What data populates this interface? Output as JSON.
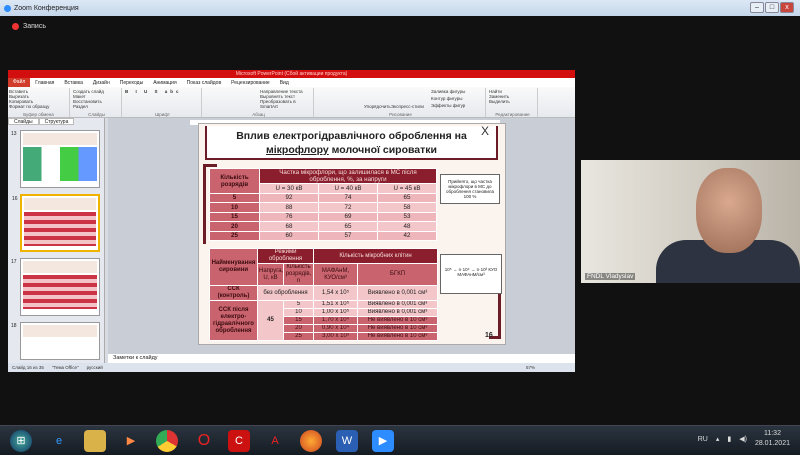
{
  "window": {
    "title": "Zoom Конференция",
    "minimize": "–",
    "maximize": "□",
    "close": "x"
  },
  "recording": {
    "label": "Запись"
  },
  "powerpoint": {
    "title": "Microsoft PowerPoint (Сбой активации продукта)",
    "menu": [
      "Файл",
      "Главная",
      "Вставка",
      "Дизайн",
      "Переходы",
      "Анимация",
      "Показ слайдов",
      "Рецензирование",
      "Вид"
    ],
    "ribbon": {
      "groups": [
        {
          "label": "Буфер обмена",
          "items": [
            "Вставить",
            "Вырезать",
            "Копировать",
            "Формат по образцу"
          ]
        },
        {
          "label": "Слайды",
          "items": [
            "Создать слайд",
            "Макет",
            "Восстановить",
            "Раздел"
          ]
        },
        {
          "label": "Шрифт",
          "items": []
        },
        {
          "label": "Абзац",
          "items": [
            "Направление текста",
            "Выровнять текст",
            "Преобразовать в SmartArt"
          ]
        },
        {
          "label": "Рисование",
          "items": [
            "Упорядочить",
            "Экспресс-стили",
            "Заливка фигуры",
            "Контур фигуры",
            "Эффекты фигур"
          ]
        },
        {
          "label": "Редактирование",
          "items": [
            "Найти",
            "Заменить",
            "Выделить"
          ]
        }
      ]
    },
    "panel_tabs": [
      "Слайды",
      "Структура"
    ],
    "thumbnails": [
      {
        "n": "13"
      },
      {
        "n": "16"
      },
      {
        "n": "17"
      },
      {
        "n": "18"
      }
    ],
    "notes_placeholder": "Заметки к слайду",
    "status": {
      "slide": "Слайд 16 из 35",
      "theme": "\"Тема Office\"",
      "language": "русский",
      "zoom": "57%"
    }
  },
  "slide": {
    "title_line1": "Вплив електрогідравлічного оброблення на",
    "title_line2_a": "мікрофлору",
    "title_line2_b": "молочної сироватки",
    "table1": {
      "head_col": "Кількість розрядів",
      "head_group": "Частка мікрофлори, що залишилася в МС після оброблення, %, за напруги",
      "cols": [
        "U = 30 кВ",
        "U = 40 кВ",
        "U = 45 кВ"
      ],
      "rows": [
        [
          "5",
          "92",
          "74",
          "65"
        ],
        [
          "10",
          "88",
          "72",
          "58"
        ],
        [
          "15",
          "76",
          "69",
          "53"
        ],
        [
          "20",
          "68",
          "65",
          "48"
        ],
        [
          "25",
          "60",
          "57",
          "42"
        ]
      ]
    },
    "note1": "Прийнято, що частка мікрофлори в МС до оброблення становила 100 %",
    "table2": {
      "h_name": "Найменування сировини",
      "h_modes": "Режими оброблення",
      "h_cells": "Кількість мікробних клітин",
      "h_voltage": "Напруга, U, кВ",
      "h_discharges": "Кількість розрядів, n",
      "h_mafanm": "МАФАнМ, КУО/см³",
      "h_bgkp": "БГКП",
      "control_name": "ССК (контроль)",
      "control_mode": "без оброблення",
      "control_mafanm": "1,54 x 10⁵",
      "control_bgkp": "Виявлено в 0,001 см³",
      "treated_name": "ССК після електро-гідравлічного оброблення",
      "treated_voltage": "45",
      "rows": [
        [
          "5",
          "1,51 x 10⁵",
          "Виявлено в 0,001 см³"
        ],
        [
          "10",
          "1,00 x 10⁵",
          "Виявлено в 0,001 см³"
        ],
        [
          "15",
          "1,70 x 10⁴",
          "Не виявлено в 10 см³"
        ],
        [
          "20",
          "0,90 x 10⁴",
          "Не виявлено в 10 см³"
        ],
        [
          "25",
          "3,00 x 10³",
          "Не виявлено в 10 см³"
        ]
      ]
    },
    "note2": "10⁵ → n·10⁴ → n·10³ КУО МАФАнМ/см³",
    "page_number": "16",
    "close_mark": "X"
  },
  "video": {
    "name": "FNDL Vladyslav"
  },
  "taskbar": {
    "apps": [
      "start",
      "ie",
      "explorer",
      "media",
      "chrome",
      "opera",
      "app",
      "acrobat",
      "firefox",
      "word",
      "zoom"
    ],
    "lang": "RU",
    "time": "11:32",
    "date": "28.01.2021"
  }
}
